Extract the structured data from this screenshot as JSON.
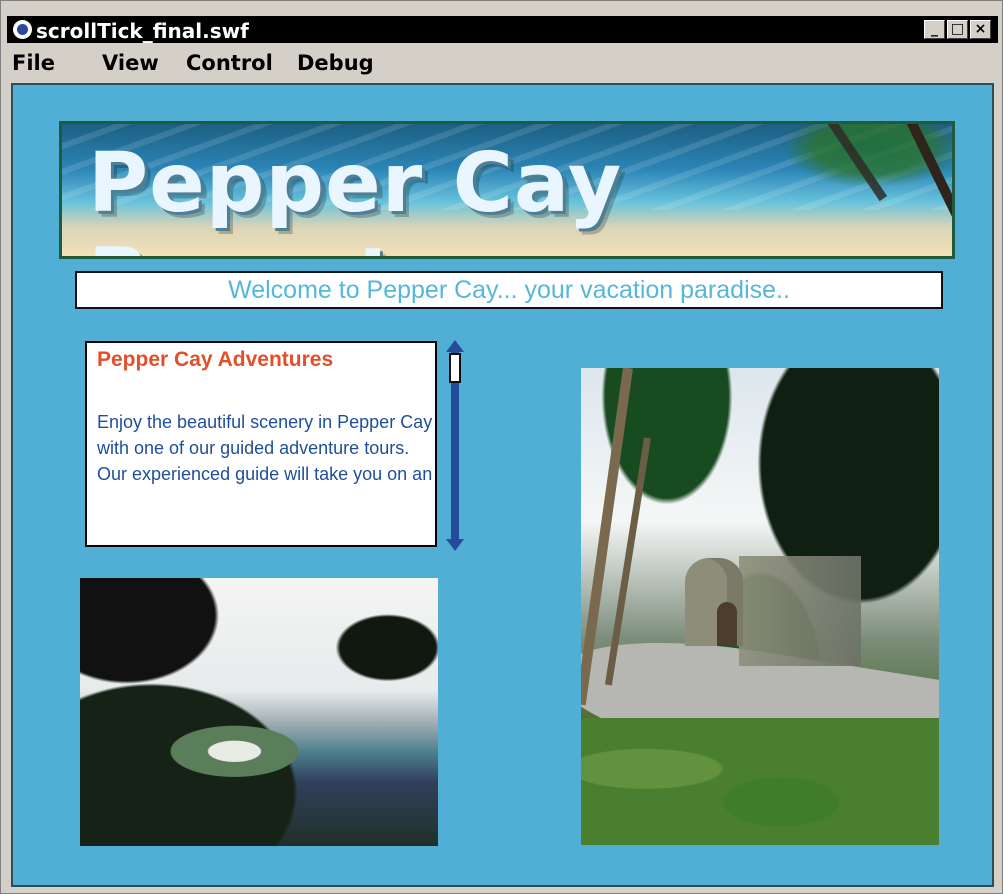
{
  "window": {
    "title": "scrollTick_final.swf",
    "controls": [
      "_",
      "□",
      "×"
    ]
  },
  "menu": {
    "items": [
      "File",
      "View",
      "Control",
      "Debug"
    ]
  },
  "banner": {
    "title": "Pepper Cay Resort"
  },
  "welcome": {
    "text": "Welcome to Pepper Cay... your vacation paradise.."
  },
  "article": {
    "title": "Pepper Cay Adventures",
    "body": "Enjoy the beautiful scenery in Pepper Cay with one of our guided adventure tours. Our experienced guide will take you on an"
  },
  "colors": {
    "stage": "#51aed5",
    "title_orange": "#e1502b",
    "body_blue": "#1f4e9a",
    "scroll_blue": "#244c9a"
  },
  "icons": {
    "app_icon": "flash-icon",
    "minimize": "minimize-icon",
    "maximize": "maximize-icon",
    "close": "close-icon"
  }
}
